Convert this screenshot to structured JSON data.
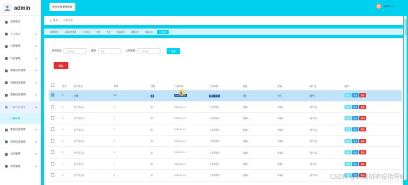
{
  "app": {
    "title": "admin"
  },
  "header": {
    "home_button": "首页系统管理系统",
    "username": "admin"
  },
  "sidebar": {
    "items": [
      {
        "label": "系统首页",
        "icon": "home-icon"
      },
      {
        "label": "个人中心",
        "icon": "user-icon"
      },
      {
        "label": "付款管理",
        "icon": "card-icon"
      },
      {
        "label": "作业管理",
        "icon": "check-icon"
      },
      {
        "label": "家庭成员管理",
        "icon": "pin-icon"
      },
      {
        "label": "进程信息管理",
        "icon": "gear-icon"
      },
      {
        "label": "家庭信息管理",
        "icon": "doc-icon"
      },
      {
        "label": "儿童信息管理",
        "icon": "child-icon"
      },
      {
        "label": "儿童信息",
        "icon": "",
        "sub": true
      },
      {
        "label": "服务信息管理",
        "icon": "list-icon"
      },
      {
        "label": "机构信息管理",
        "icon": "building-icon"
      },
      {
        "label": "活动管理",
        "icon": "flag-icon"
      },
      {
        "label": "系统管理",
        "icon": "settings-icon"
      }
    ]
  },
  "breadcrumb": {
    "home": "首页",
    "current": "儿童信息"
  },
  "tabs": [
    "系统首页",
    "儿童信息管理",
    "个人信息",
    "付款",
    "作业",
    "家庭成员",
    "进程信息",
    "家庭信息",
    "儿童信息"
  ],
  "filters": {
    "name_label": "孩子姓名",
    "name_placeholder": "孩子姓名",
    "gender_label": "性别",
    "gender_placeholder": "性别",
    "school_label": "入学学校",
    "school_placeholder": "入学学校",
    "search_button": "查询"
  },
  "delete_button": "删除",
  "table": {
    "headers": [
      "",
      "序号",
      "孩子姓名",
      "年龄",
      "性别",
      "入学时间",
      "入学学校",
      "班级",
      "年级",
      "用户名",
      "操作"
    ],
    "rows": [
      [
        "1",
        "小明",
        "10",
        "男",
        "2020-01-01",
        "厦门大学",
        "1班",
        "六三",
        "用户1"
      ],
      [
        "2",
        "孩子姓名2",
        "2",
        "男",
        "2024-01-13",
        "入学学校2",
        "班级2",
        "年级2",
        "用户名2"
      ],
      [
        "3",
        "孩子姓名3",
        "3",
        "男",
        "2024-01-13",
        "入学学校3",
        "班级3",
        "年级3",
        "用户名3"
      ],
      [
        "4",
        "孩子姓名4",
        "4",
        "男",
        "2024-01-13",
        "入学学校4",
        "班级4",
        "年级4",
        "用户名4"
      ],
      [
        "5",
        "孩子姓名5",
        "5",
        "男",
        "2024-01-13",
        "入学学校5",
        "班级5",
        "年级5",
        "用户名5"
      ],
      [
        "6",
        "孩子姓名6",
        "6",
        "男",
        "2024-01-13",
        "入学学校6",
        "班级6",
        "年级6",
        "用户名6"
      ],
      [
        "7",
        "孩子姓名7",
        "7",
        "男",
        "2024-01-13",
        "入学学校7",
        "班级7",
        "年级7",
        "用户名7"
      ],
      [
        "8",
        "孩子姓名8",
        "8",
        "男",
        "2024-01-13",
        "入学学校8",
        "班级8",
        "年级8",
        "用户名8"
      ]
    ],
    "actions": {
      "view": "查看",
      "edit": "修改",
      "delete": "删除"
    }
  },
  "watermark": "CSDN @计算机毕设指导6",
  "colors": {
    "accent": "#00cfee",
    "danger": "#e0302f",
    "selected_row": "#bfe3fb"
  }
}
